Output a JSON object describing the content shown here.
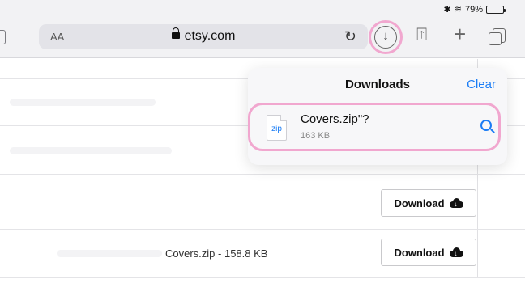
{
  "status": {
    "signal": "✱ ",
    "wifi": "≋",
    "battery_pct": "79%",
    "battery_level": 0.79
  },
  "toolbar": {
    "text_size_label": "AA",
    "domain": "etsy.com",
    "reload_glyph": "↻",
    "download_glyph": "↓",
    "share_glyph": "⍐",
    "new_tab_glyph": "+"
  },
  "page": {
    "rows": [
      {
        "button_label": "Download",
        "file_label": ""
      },
      {
        "button_label": "Download",
        "file_label": "Covers.zip - 158.8 KB"
      }
    ]
  },
  "downloads": {
    "title": "Downloads",
    "clear_label": "Clear",
    "item": {
      "file_type": "zip",
      "name": "Covers.zip\"?",
      "size": "163 KB"
    }
  }
}
